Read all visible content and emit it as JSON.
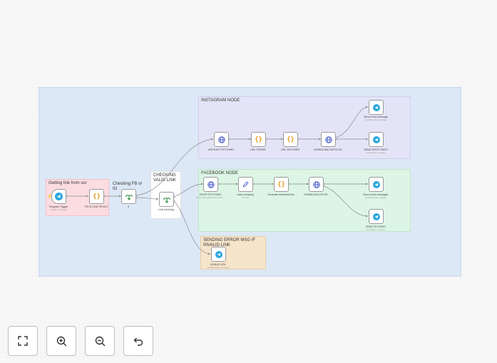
{
  "groups": {
    "trigger": "Getting link from usr",
    "checking": "Checking FB or IG",
    "valid": "CHECKING VALID LINK",
    "instagram": "INSTAGRAM NODE",
    "facebook": "FACEBOOK NODE",
    "error": "SENDING ERROR MSG IF INVALID LINK"
  },
  "nodes": {
    "telegram_trigger": {
      "label": "Telegram Trigger",
      "sub": "updates: message"
    },
    "fb_ig_regex": {
      "label": "FB IG LINK REGEX"
    },
    "if_fb_ig": {
      "label": "If"
    },
    "link_checking": {
      "label": "Link checking"
    },
    "insta_api": {
      "label": "INSTA API FETCHING"
    },
    "url_finder": {
      "label": "URL FINDER"
    },
    "url_decoder": {
      "label": "URL DECODER"
    },
    "download_insta": {
      "label": "DOWNLOAD INSTA VID"
    },
    "send_text_ig": {
      "label": "Send a text message",
      "sub": "sendMessage: message"
    },
    "send_insta_video": {
      "label": "SEND INSTA VIDEO",
      "sub": "sendVideo: message"
    },
    "fb_api": {
      "label": "FB API FETCHING",
      "sub": "POST: https://facebook-media-..."
    },
    "video_scraping": {
      "label": "video scraping",
      "sub": "manual"
    },
    "generate_link": {
      "label": "Generate download link"
    },
    "download_fb": {
      "label": "DOWNLOAD FB VID"
    },
    "send_text_fb": {
      "label": "Send a text message1",
      "sub": "sendMessage: message"
    },
    "send_fb_video": {
      "label": "SEND FB VIDEO",
      "sub": "sendVideo: message"
    },
    "invalid_url": {
      "label": "INVALID URL",
      "sub": "sendMessage: message"
    }
  },
  "controls": {
    "fit": "fit-view-icon",
    "zoom_in": "zoom-in-icon",
    "zoom_out": "zoom-out-icon",
    "undo": "undo-icon"
  },
  "colors": {
    "workflow_bg": "#dde8f6",
    "instagram_group": "#e5e4f7",
    "facebook_group": "#dcf5e4",
    "trigger_group": "#fbdde1",
    "error_group": "#f6e5cb",
    "telegram": "#2aa7de",
    "code": "#e59b16",
    "router": "#4a9a5c",
    "http": "#3b4fc4"
  }
}
